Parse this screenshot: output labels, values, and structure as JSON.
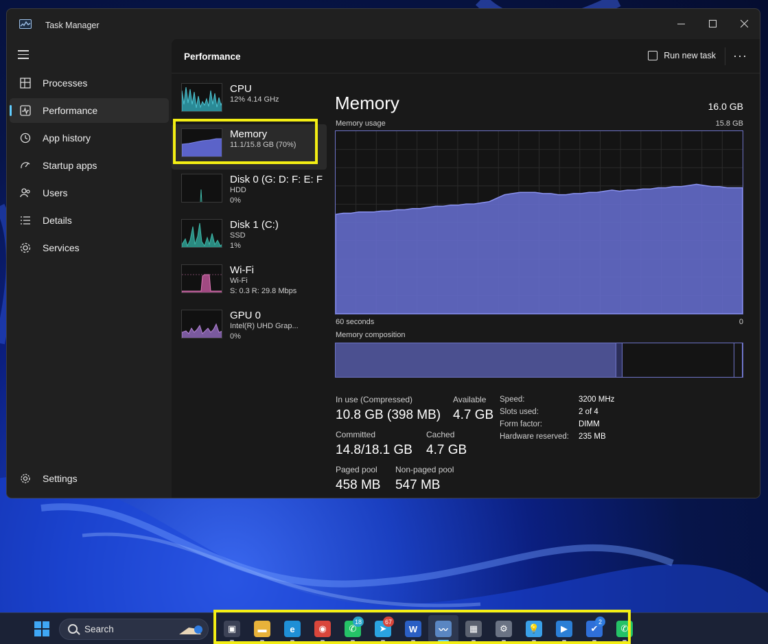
{
  "window": {
    "title": "Task Manager"
  },
  "sidebar": {
    "items": [
      {
        "label": "Processes",
        "icon": "processes-icon"
      },
      {
        "label": "Performance",
        "icon": "performance-icon",
        "active": true
      },
      {
        "label": "App history",
        "icon": "history-icon"
      },
      {
        "label": "Startup apps",
        "icon": "startup-icon"
      },
      {
        "label": "Users",
        "icon": "users-icon"
      },
      {
        "label": "Details",
        "icon": "details-icon"
      },
      {
        "label": "Services",
        "icon": "services-icon"
      }
    ],
    "settings_label": "Settings"
  },
  "header": {
    "title": "Performance",
    "run_task_label": "Run new task",
    "more_label": "···"
  },
  "resources": [
    {
      "name": "CPU",
      "line1": "12% 4.14 GHz",
      "line2": "",
      "color": "#4fc3d1"
    },
    {
      "name": "Memory",
      "line1": "11.1/15.8 GB (70%)",
      "line2": "",
      "color": "#7b84e8",
      "selected": true
    },
    {
      "name": "Disk 0 (G: D: F: E: F",
      "line1": "HDD",
      "line2": "0%",
      "color": "#3fb8a8"
    },
    {
      "name": "Disk 1 (C:)",
      "line1": "SSD",
      "line2": "1%",
      "color": "#3fb8a8"
    },
    {
      "name": "Wi-Fi",
      "line1": "Wi-Fi",
      "line2": "S: 0.3 R: 29.8 Mbps",
      "color": "#e07ab8"
    },
    {
      "name": "GPU 0",
      "line1": "Intel(R) UHD Grap...",
      "line2": "0%",
      "color": "#b785d8"
    }
  ],
  "memory": {
    "title": "Memory",
    "total": "16.0 GB",
    "usage_label": "Memory usage",
    "usage_max": "15.8 GB",
    "graph_left": "60 seconds",
    "graph_right": "0",
    "composition_label": "Memory composition",
    "usage_series_gb": [
      8.6,
      8.7,
      8.7,
      8.8,
      8.8,
      8.8,
      8.9,
      8.9,
      9.0,
      9.0,
      9.1,
      9.1,
      9.2,
      9.3,
      9.3,
      9.4,
      9.4,
      9.5,
      9.5,
      9.6,
      9.7,
      10.0,
      10.3,
      10.4,
      10.5,
      10.5,
      10.5,
      10.4,
      10.4,
      10.3,
      10.3,
      10.4,
      10.4,
      10.5,
      10.5,
      10.6,
      10.7,
      10.6,
      10.7,
      10.7,
      10.8,
      10.8,
      10.9,
      10.9,
      11.0,
      11.0,
      11.1,
      11.2,
      11.1,
      11.0,
      11.0,
      10.9,
      10.9,
      10.9
    ],
    "composition_fractions": {
      "in_use": 0.69,
      "modified": 0.015,
      "standby": 0.275,
      "free": 0.02
    },
    "stats": {
      "in_use_label": "In use (Compressed)",
      "in_use_value": "10.8 GB (398 MB)",
      "available_label": "Available",
      "available_value": "4.7 GB",
      "committed_label": "Committed",
      "committed_value": "14.8/18.1 GB",
      "cached_label": "Cached",
      "cached_value": "4.7 GB",
      "paged_label": "Paged pool",
      "paged_value": "458 MB",
      "nonpaged_label": "Non-paged pool",
      "nonpaged_value": "547 MB"
    },
    "specs": {
      "speed_label": "Speed:",
      "speed_value": "3200 MHz",
      "slots_label": "Slots used:",
      "slots_value": "2 of 4",
      "form_label": "Form factor:",
      "form_value": "DIMM",
      "hw_label": "Hardware reserved:",
      "hw_value": "235 MB"
    }
  },
  "taskbar": {
    "search_label": "Search",
    "apps": [
      {
        "name": "task-view-icon",
        "bg": "#3c4256",
        "glyph": "▣"
      },
      {
        "name": "file-explorer-icon",
        "bg": "#e8b23a",
        "glyph": "▬"
      },
      {
        "name": "edge-icon",
        "bg": "#1f8fd6",
        "glyph": "e"
      },
      {
        "name": "chrome-icon",
        "bg": "#d9463b",
        "glyph": "◉"
      },
      {
        "name": "whatsapp-icon",
        "bg": "#25c267",
        "glyph": "✆",
        "badge": "18",
        "badge_color": "#2aa6c9"
      },
      {
        "name": "telegram-icon",
        "bg": "#2aa3e0",
        "glyph": "➤",
        "badge": "67",
        "badge_color": "#d9463b"
      },
      {
        "name": "word-icon",
        "bg": "#2b5fc4",
        "glyph": "W"
      },
      {
        "name": "task-manager-icon",
        "bg": "#5a86c2",
        "glyph": "〰",
        "active": true
      },
      {
        "name": "calculator-icon",
        "bg": "#5c6270",
        "glyph": "▦"
      },
      {
        "name": "settings-icon",
        "bg": "#6b7384",
        "glyph": "⚙"
      },
      {
        "name": "tips-icon",
        "bg": "#3aa0e8",
        "glyph": "💡"
      },
      {
        "name": "media-player-icon",
        "bg": "#2b7fd6",
        "glyph": "▶"
      },
      {
        "name": "todo-icon",
        "bg": "#2f6fd8",
        "glyph": "✔",
        "badge": "2",
        "badge_color": "#2f7be0"
      },
      {
        "name": "whatsapp-icon-2",
        "bg": "#25c267",
        "glyph": "✆"
      }
    ]
  }
}
